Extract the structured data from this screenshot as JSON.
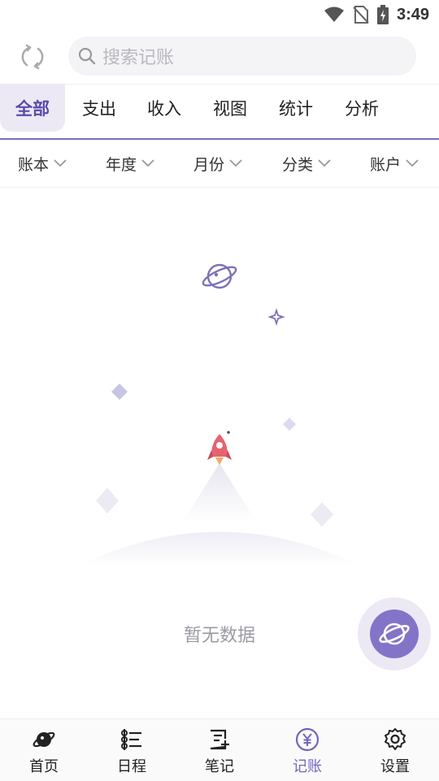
{
  "status_bar": {
    "time": "3:49"
  },
  "search": {
    "placeholder": "搜索记账"
  },
  "tabs": [
    {
      "label": "全部",
      "active": true
    },
    {
      "label": "支出"
    },
    {
      "label": "收入"
    },
    {
      "label": "视图"
    },
    {
      "label": "统计"
    },
    {
      "label": "分析"
    }
  ],
  "filters": [
    {
      "label": "账本"
    },
    {
      "label": "年度"
    },
    {
      "label": "月份"
    },
    {
      "label": "分类"
    },
    {
      "label": "账户"
    }
  ],
  "empty_state": {
    "text": "暂无数据"
  },
  "bottom_nav": [
    {
      "label": "首页",
      "icon": "planet-icon"
    },
    {
      "label": "日程",
      "icon": "schedule-list-icon"
    },
    {
      "label": "笔记",
      "icon": "note-add-icon"
    },
    {
      "label": "记账",
      "icon": "yuan-circle-icon",
      "active": true
    },
    {
      "label": "设置",
      "icon": "gear-icon"
    }
  ],
  "colors": {
    "accent": "#7b6bbf",
    "tab_active_bg": "#ece9f5",
    "fab": "#8474c7"
  }
}
